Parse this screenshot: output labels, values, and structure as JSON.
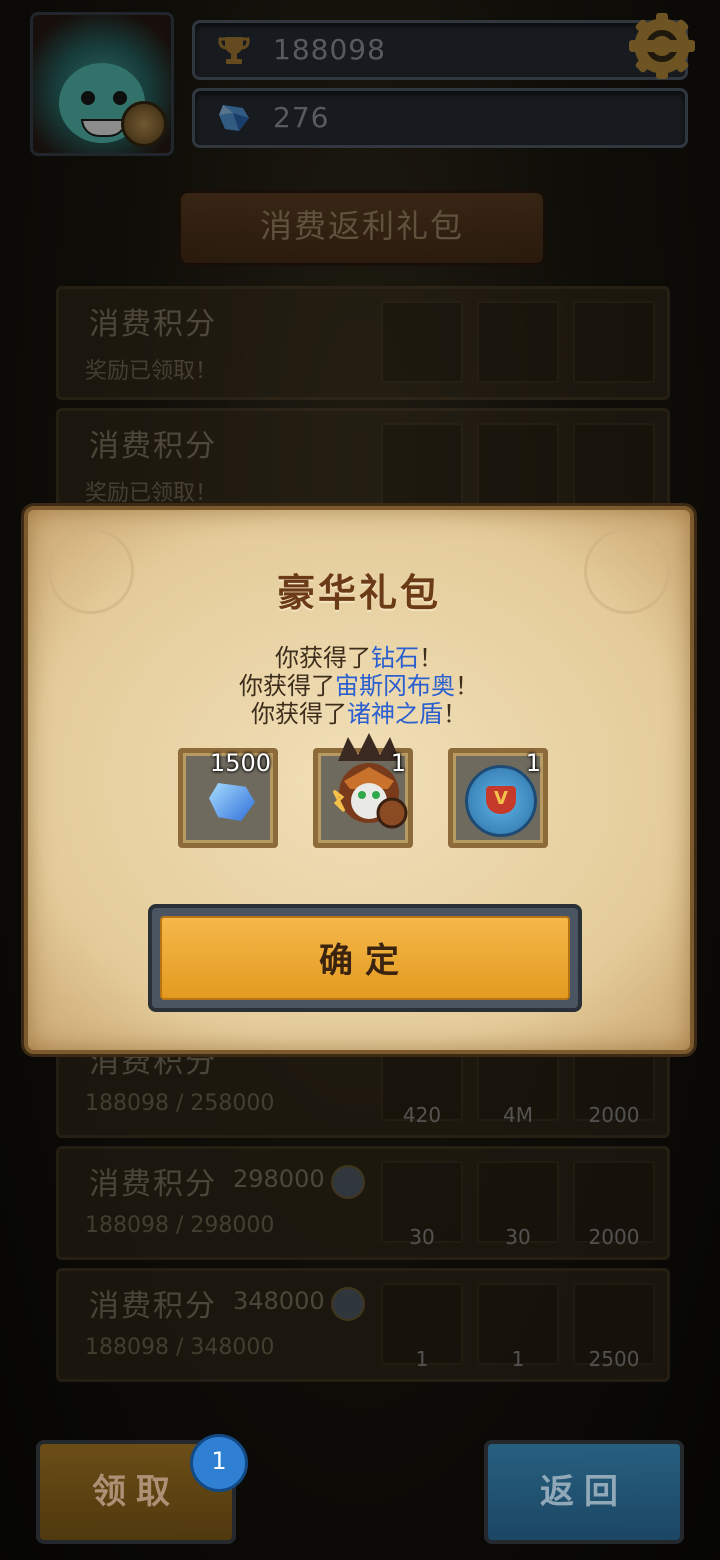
{
  "resources": {
    "trophy": "188098",
    "diamonds": "276"
  },
  "banner": {
    "title": "消费返利礼包"
  },
  "list": [
    {
      "title": "消费积分",
      "points": "",
      "status": "奖励已领取！",
      "counts": [
        "",
        "",
        ""
      ]
    },
    {
      "title": "消费积分",
      "points": "",
      "status": "奖励已领取！",
      "counts": [
        "",
        "",
        ""
      ]
    },
    {
      "title": "消费积分",
      "points": "",
      "status": "188098 / 258000",
      "counts": [
        "420",
        "4M",
        "2000"
      ]
    },
    {
      "title": "消费积分",
      "points": "298000",
      "status": "188098 / 298000",
      "counts": [
        "30",
        "30",
        "2000"
      ]
    },
    {
      "title": "消费积分",
      "points": "348000",
      "status": "188098 / 348000",
      "counts": [
        "1",
        "1",
        "2500"
      ]
    }
  ],
  "popup": {
    "title": "豪华礼包",
    "prefix": "你获得了",
    "suffix": "！",
    "items": [
      {
        "name": "钻石",
        "qty": "1500",
        "icon": "diamond-icon"
      },
      {
        "name": "宙斯冈布奥",
        "qty": "1",
        "icon": "hero-zeus-icon"
      },
      {
        "name": "诸神之盾",
        "qty": "1",
        "icon": "shield-of-gods-icon"
      }
    ],
    "confirm": "确定"
  },
  "buttons": {
    "claim": "领取",
    "claim_badge": "1",
    "back": "返回"
  },
  "colors": {
    "highlight": "#2a5fd0",
    "confirm": "#e9a429",
    "back": "#2d6f95"
  }
}
